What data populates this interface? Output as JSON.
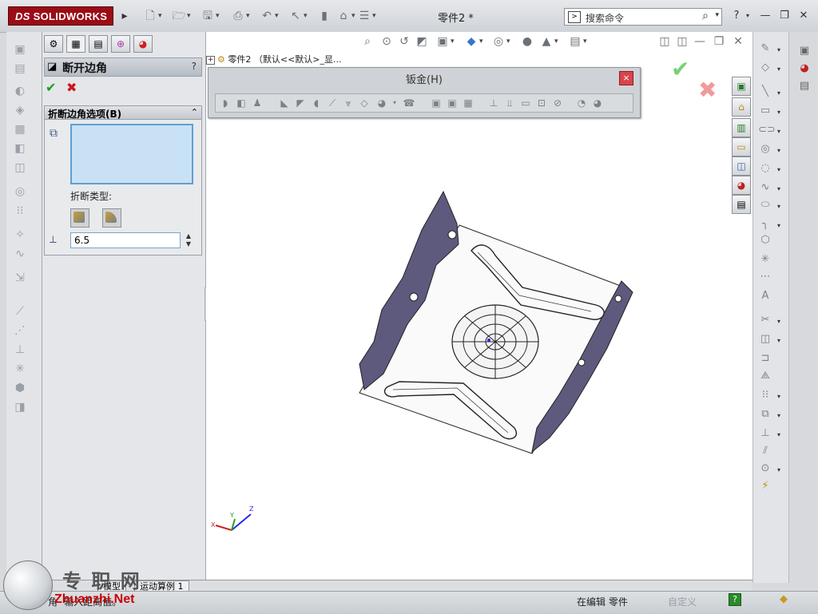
{
  "app": {
    "brand": "SOLIDWORKS",
    "brand_prefix": "DS"
  },
  "window": {
    "title": "零件2 *",
    "search_placeholder": "搜索命令",
    "help": "?"
  },
  "feature_tree": {
    "root": "零件2 （默认<<默认>_显..."
  },
  "property_manager": {
    "title": "断开边角",
    "help": "?",
    "section_title": "折断边角选项(B)",
    "break_type_label": "折断类型:",
    "distance_value": "6.5",
    "tabs": [
      "feature-manager-tab",
      "property-manager-tab",
      "configuration-manager-tab",
      "dimxpert-tab",
      "display-manager-tab"
    ]
  },
  "sheet_metal_toolbar": {
    "title": "钣金(H)",
    "close": "×"
  },
  "bottom_tabs": [
    "模型",
    "运动算例 1"
  ],
  "status_bar": {
    "left": "角- 输入距离值。",
    "editing": "在编辑 零件",
    "custom": "自定义"
  },
  "watermark": {
    "text1": "专 职 网",
    "text2": "Zhuanzhi.Net"
  },
  "triad_labels": {
    "x": "X",
    "y": "Y",
    "z": "Z"
  },
  "colors": {
    "accent_red": "#9b0c16",
    "selection_box": "#c9e1f4",
    "ok_green": "#12a312",
    "cancel_red": "#cc1818"
  }
}
